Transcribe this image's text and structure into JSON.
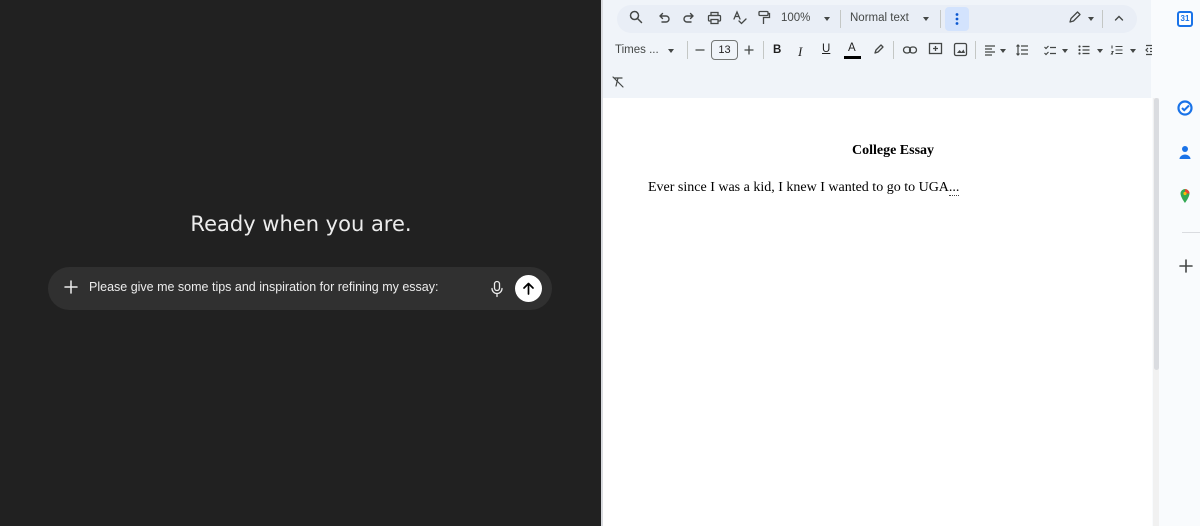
{
  "chat": {
    "heading": "Ready when you are.",
    "prompt_text": "Please give me some tips and inspiration for refining my essay:",
    "icons": {
      "add": "plus-icon",
      "mic": "microphone-icon",
      "send": "arrow-up-icon"
    }
  },
  "docs": {
    "toolbar": {
      "zoom": "100%",
      "style": "Normal text",
      "font": "Times ...",
      "font_size": "13",
      "bold": "B",
      "italic": "I",
      "underline": "U",
      "text_color": "A"
    },
    "document": {
      "title": "College Essay",
      "body_text": "Ever since I was a kid, I knew I wanted to go to UGA",
      "body_ellipsis": "..."
    },
    "sidepanel": {
      "calendar_label": "31"
    },
    "colors": {
      "accent_blue": "#0b57d0",
      "toolbar_bg": "#f0f4f9",
      "chat_bg": "#212121"
    }
  }
}
